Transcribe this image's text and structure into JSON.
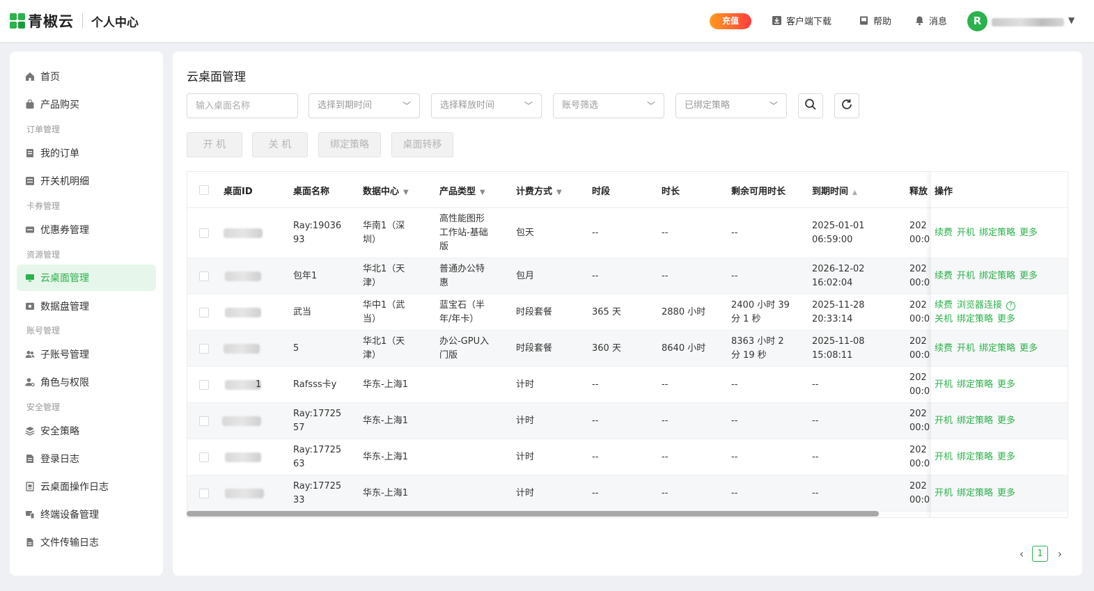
{
  "header": {
    "brand": "青椒云",
    "section": "个人中心",
    "recharge": "充值",
    "nav": [
      {
        "label": "客户端下载",
        "icon": "download-icon"
      },
      {
        "label": "帮助",
        "icon": "book-icon"
      },
      {
        "label": "消息",
        "icon": "bell-icon"
      }
    ],
    "avatar_letter": "R"
  },
  "sidebar": {
    "items": [
      {
        "label": "首页",
        "icon": "home-icon"
      },
      {
        "label": "产品购买",
        "icon": "bag-icon"
      },
      {
        "label": "我的订单",
        "icon": "order-icon"
      },
      {
        "label": "开关机明细",
        "icon": "list-icon"
      },
      {
        "label": "优惠券管理",
        "icon": "coupon-icon"
      },
      {
        "label": "云桌面管理",
        "icon": "monitor-icon"
      },
      {
        "label": "数据盘管理",
        "icon": "disk-icon"
      },
      {
        "label": "子账号管理",
        "icon": "users-icon"
      },
      {
        "label": "角色与权限",
        "icon": "user-key-icon"
      },
      {
        "label": "安全策略",
        "icon": "layers-icon"
      },
      {
        "label": "登录日志",
        "icon": "doc-icon"
      },
      {
        "label": "云桌面操作日志",
        "icon": "log-icon"
      },
      {
        "label": "终端设备管理",
        "icon": "devices-icon"
      },
      {
        "label": "文件传输日志",
        "icon": "file-icon"
      }
    ],
    "groups": [
      "订单管理",
      "卡券管理",
      "资源管理",
      "账号管理",
      "安全管理"
    ]
  },
  "main": {
    "title": "云桌面管理",
    "filters": {
      "name_placeholder": "输入桌面名称",
      "expire": "选择到期时间",
      "release": "选择释放时间",
      "account": "账号筛选",
      "policy": "已绑定策略"
    },
    "actions": [
      "开 机",
      "关 机",
      "绑定策略",
      "桌面转移"
    ],
    "columns": [
      "桌面ID",
      "桌面名称",
      "数据中心",
      "产品类型",
      "计费方式",
      "时段",
      "时长",
      "剩余可用时长",
      "到期时间",
      "释放",
      "操作"
    ],
    "rows": [
      {
        "id_tail": "",
        "name": "Ray:19036\n93",
        "dc": "华南1（深\n圳）",
        "product": "高性能图形\n工作站-基础\n版",
        "billing": "包天",
        "period": "--",
        "duration": "--",
        "remaining": "--",
        "expire": "2025-01-01\n06:59:00",
        "release": "202\n00:0",
        "ops": [
          "续费",
          "开机",
          "绑定策略",
          "更多"
        ]
      },
      {
        "id_tail": "",
        "name": "包年1",
        "dc": "华北1（天\n津）",
        "product": "普通办公特\n惠",
        "billing": "包月",
        "period": "--",
        "duration": "--",
        "remaining": "--",
        "expire": "2026-12-02\n16:02:04",
        "release": "202\n00:0",
        "ops": [
          "续费",
          "开机",
          "绑定策略",
          "更多"
        ]
      },
      {
        "id_tail": "",
        "name": "武当",
        "dc": "华中1（武\n当）",
        "product": "蓝宝石（半\n年/年卡）",
        "billing": "时段套餐",
        "period": "365 天",
        "duration": "2880 小时",
        "remaining": "2400 小时 39\n分 1 秒",
        "expire": "2025-11-28\n20:33:14",
        "release": "202\n00:0",
        "ops": [
          "续费",
          "浏览器连接"
        ],
        "ops2": [
          "关机",
          "绑定策略",
          "更多"
        ]
      },
      {
        "id_tail": "",
        "name": "5",
        "dc": "华北1（天\n津）",
        "product": "办公-GPU入\n门版",
        "billing": "时段套餐",
        "period": "360 天",
        "duration": "8640 小时",
        "remaining": "8363 小时 2\n分 19 秒",
        "expire": "2025-11-08\n15:08:11",
        "release": "202\n00:0",
        "ops": [
          "续费",
          "开机",
          "绑定策略",
          "更多"
        ]
      },
      {
        "id_tail": "1",
        "name": "Rafsss卡y",
        "dc": "华东-上海1",
        "product": "",
        "billing": "计时",
        "period": "--",
        "duration": "--",
        "remaining": "--",
        "expire": "--",
        "release": "202\n00:0",
        "ops": [
          "开机",
          "绑定策略",
          "更多"
        ]
      },
      {
        "id_tail": "",
        "name": "Ray:17725\n57",
        "dc": "华东-上海1",
        "product": "",
        "billing": "计时",
        "period": "--",
        "duration": "--",
        "remaining": "--",
        "expire": "--",
        "release": "202\n00:0",
        "ops": [
          "开机",
          "绑定策略",
          "更多"
        ]
      },
      {
        "id_tail": "",
        "name": "Ray:17725\n63",
        "dc": "华东-上海1",
        "product": "",
        "billing": "计时",
        "period": "--",
        "duration": "--",
        "remaining": "--",
        "expire": "--",
        "release": "202\n00:0",
        "ops": [
          "开机",
          "绑定策略",
          "更多"
        ]
      },
      {
        "id_tail": "",
        "name": "Ray:17725\n33",
        "dc": "华东-上海1",
        "product": "",
        "billing": "计时",
        "period": "--",
        "duration": "--",
        "remaining": "--",
        "expire": "--",
        "release": "202\n00:0",
        "ops": [
          "开机",
          "绑定策略",
          "更多"
        ]
      }
    ],
    "pagination": {
      "current": "1"
    }
  },
  "colors": {
    "accent": "#2bb24c",
    "recharge_from": "#ff9a1f",
    "recharge_to": "#ff3d3d"
  }
}
